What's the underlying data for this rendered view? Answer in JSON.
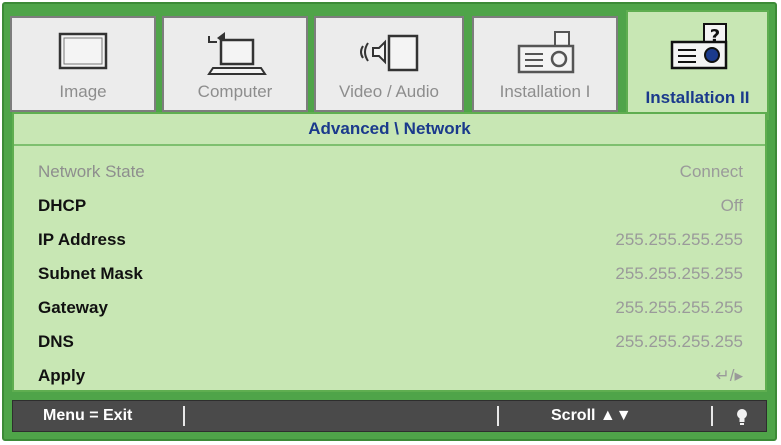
{
  "tabs": [
    {
      "label": "Image",
      "icon": "monitor-icon",
      "active": false
    },
    {
      "label": "Computer",
      "icon": "laptop-icon",
      "active": false
    },
    {
      "label": "Video / Audio",
      "icon": "speaker-screen-icon",
      "active": false
    },
    {
      "label": "Installation I",
      "icon": "projector-icon",
      "active": false
    },
    {
      "label": "Installation II",
      "icon": "projector-help-icon",
      "active": true
    }
  ],
  "panel": {
    "title": "Advanced \\ Network",
    "rows": [
      {
        "label": "Network State",
        "value": "Connect"
      },
      {
        "label": "DHCP",
        "value": "Off"
      },
      {
        "label": "IP Address",
        "value": "255.255.255.255"
      },
      {
        "label": "Subnet Mask",
        "value": "255.255.255.255"
      },
      {
        "label": "Gateway",
        "value": "255.255.255.255"
      },
      {
        "label": "DNS",
        "value": "255.255.255.255"
      },
      {
        "label": "Apply",
        "value": "↵/▸"
      }
    ]
  },
  "footer": {
    "menu_hint": "Menu = Exit",
    "scroll_hint": "Scroll ▲▼"
  },
  "colors": {
    "frame": "#4fa449",
    "panel": "#c8e7b4",
    "accent_text": "#1b3a8c",
    "footer": "#4a4a4a"
  }
}
